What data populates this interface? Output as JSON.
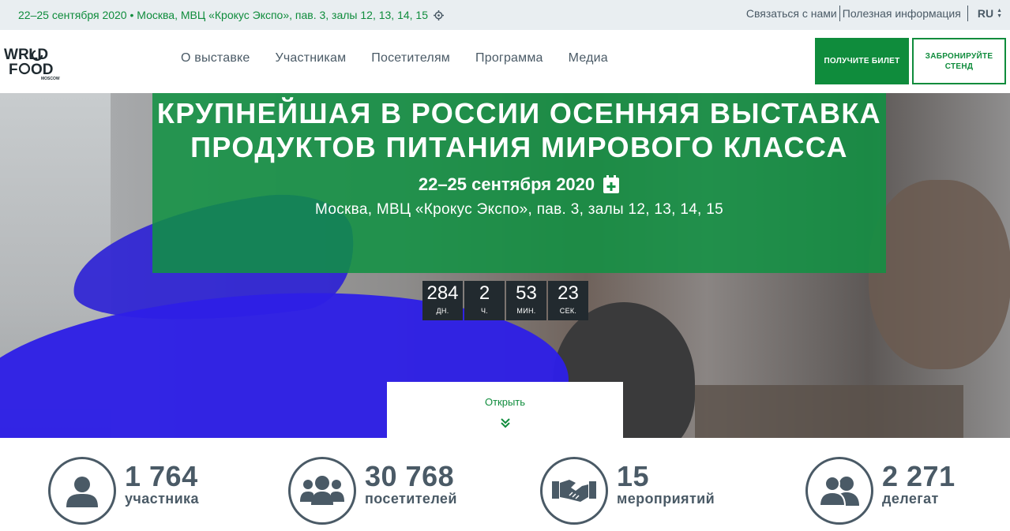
{
  "topbar": {
    "event_info": "22–25 сентября 2020 • Москва, МВЦ «Крокус Экспо», пав. 3, залы 12, 13, 14, 15",
    "links": [
      "Связаться с нами",
      "Полезная информация"
    ],
    "language": "RU"
  },
  "header": {
    "logo_text": "WORLD FOOD MOSCOW",
    "nav": [
      "О выставке",
      "Участникам",
      "Посетителям",
      "Программа",
      "Медиа"
    ],
    "ticket_button": "ПОЛУЧИТЕ БИЛЕТ",
    "stand_button": "ЗАБРОНИРУЙТЕ СТЕНД"
  },
  "hero": {
    "headline": "КРУПНЕЙШАЯ В РОССИИ ОСЕННЯЯ ВЫСТАВКА ПРОДУКТОВ ПИТАНИЯ МИРОВОГО КЛАССА",
    "date": "22–25 сентября 2020",
    "venue": "Москва, МВЦ «Крокус Экспо», пав. 3, залы 12, 13, 14, 15",
    "countdown": [
      {
        "value": "284",
        "unit": "ДН."
      },
      {
        "value": "2",
        "unit": "Ч."
      },
      {
        "value": "53",
        "unit": "МИН."
      },
      {
        "value": "23",
        "unit": "СЕК."
      }
    ],
    "open_label": "Открыть"
  },
  "stats": [
    {
      "number": "1 764",
      "label": "участника",
      "icon": "user-icon"
    },
    {
      "number": "30 768",
      "label": "посетителей",
      "icon": "group-icon"
    },
    {
      "number": "15",
      "label": "мероприятий",
      "icon": "handshake-icon"
    },
    {
      "number": "2 271",
      "label": "делегат",
      "icon": "users-icon"
    }
  ],
  "colors": {
    "brand_green": "#0f8c3c",
    "text_dark": "#4a5a66",
    "topbar_bg": "#e9eef1"
  }
}
